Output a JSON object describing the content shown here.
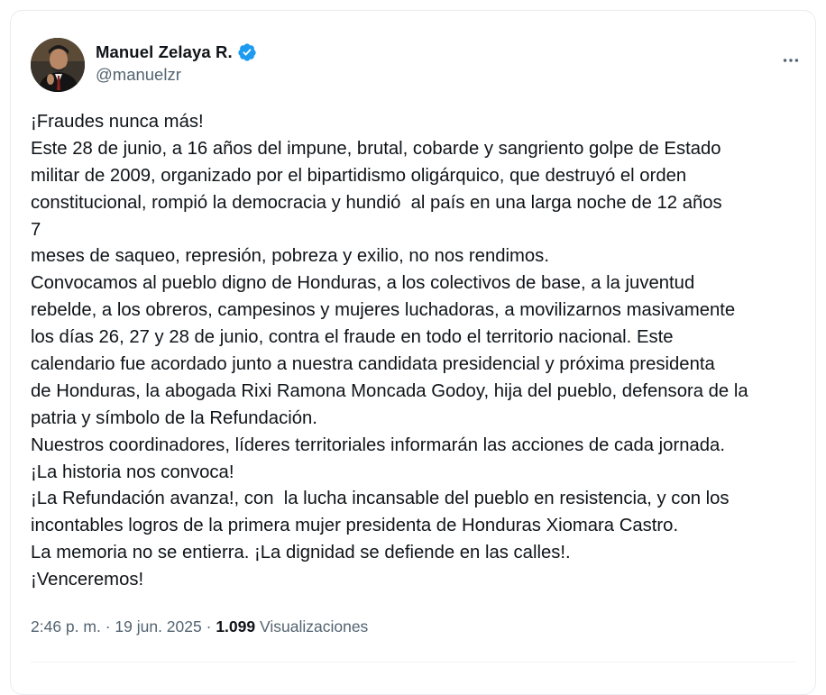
{
  "author": {
    "display_name": "Manuel Zelaya R.",
    "handle": "@manuelzr",
    "verified_icon": "verified-badge-icon",
    "verified_color": "#1d9bf0",
    "avatar_icon": "profile-avatar"
  },
  "more_icon": "more-options-icon",
  "tweet": {
    "lines": [
      "¡Fraudes nunca más!",
      "Este 28 de junio, a 16 años del impune, brutal, cobarde y sangriento golpe de Estado",
      "militar de 2009, organizado por el bipartidismo oligárquico, que destruyó el orden",
      "constitucional, rompió la democracia y hundió  al país en una larga noche de 12 años",
      "7",
      "meses de saqueo, represión, pobreza y exilio, no nos rendimos.",
      "Convocamos al pueblo digno de Honduras, a los colectivos de base, a la juventud",
      "rebelde, a los obreros, campesinos y mujeres luchadoras, a movilizarnos masivamente",
      "los días 26, 27 y 28 de junio, contra el fraude en todo el territorio nacional. Este",
      "calendario fue acordado junto a nuestra candidata presidencial y próxima presidenta",
      "de Honduras, la abogada Rixi Ramona Moncada Godoy, hija del pueblo, defensora de la",
      "patria y símbolo de la Refundación.",
      "Nuestros coordinadores, líderes territoriales informarán las acciones de cada jornada.",
      "¡La historia nos convoca!",
      "¡La Refundación avanza!, con  la lucha incansable del pueblo en resistencia, y con los",
      "incontables logros de la primera mujer presidenta de Honduras Xiomara Castro.",
      "La memoria no se entierra. ¡La dignidad se defiende en las calles!.",
      "¡Venceremos!"
    ]
  },
  "meta": {
    "time": "2:46 p. m.",
    "separator": "·",
    "date": "19 jun. 2025",
    "views_count": "1.099",
    "views_label": "Visualizaciones"
  }
}
